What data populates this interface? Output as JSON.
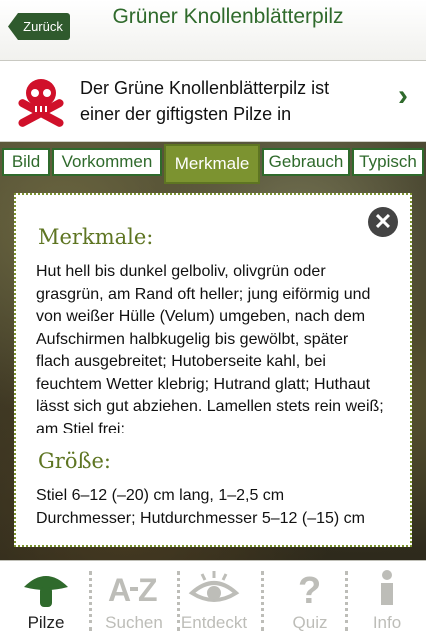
{
  "header": {
    "back_label": "Zurück",
    "title": "Grüner Knollenblätterpilz"
  },
  "banner": {
    "text": "Der Grüne Knollenblätterpilz ist einer der giftigsten Pilze in"
  },
  "tabs": [
    {
      "label": "Bild"
    },
    {
      "label": "Vorkommen"
    },
    {
      "label": "Merkmale",
      "active": true
    },
    {
      "label": "Gebrauch"
    },
    {
      "label": "Typisch"
    }
  ],
  "content": {
    "merkmale_heading": "Merkmale:",
    "merkmale_text": "Hut hell bis dunkel gelboliv, olivgrün oder grasgrün, am Rand oft heller; jung eiförmig und von weißer Hülle (Velum) umgeben, nach dem Aufschirmen halbkugelig bis gewölbt, später flach ausgebreitet; Hutoberseite kahl, bei feuchtem Wetter klebrig; Hutrand glatt; Huthaut lässt sich gut abziehen. Lamellen stets rein weiß; am Stiel frei;",
    "groesse_heading": "Größe:",
    "groesse_text": "Stiel 6–12 (–20) cm lang, 1–2,5 cm Durchmesser; Hutdurchmesser 5–12 (–15) cm"
  },
  "bottom_nav": [
    {
      "label": "Pilze",
      "icon": "mushroom-icon",
      "active": true
    },
    {
      "label": "Suchen",
      "icon": "a-z-icon"
    },
    {
      "label": "Entdeckt",
      "icon": "eye-icon"
    },
    {
      "label": "Quiz",
      "icon": "question-icon"
    },
    {
      "label": "Info",
      "icon": "info-icon"
    }
  ],
  "colors": {
    "brand_green": "#2f6a2c",
    "accent_olive": "#7c9330",
    "danger_red": "#d0102a"
  }
}
